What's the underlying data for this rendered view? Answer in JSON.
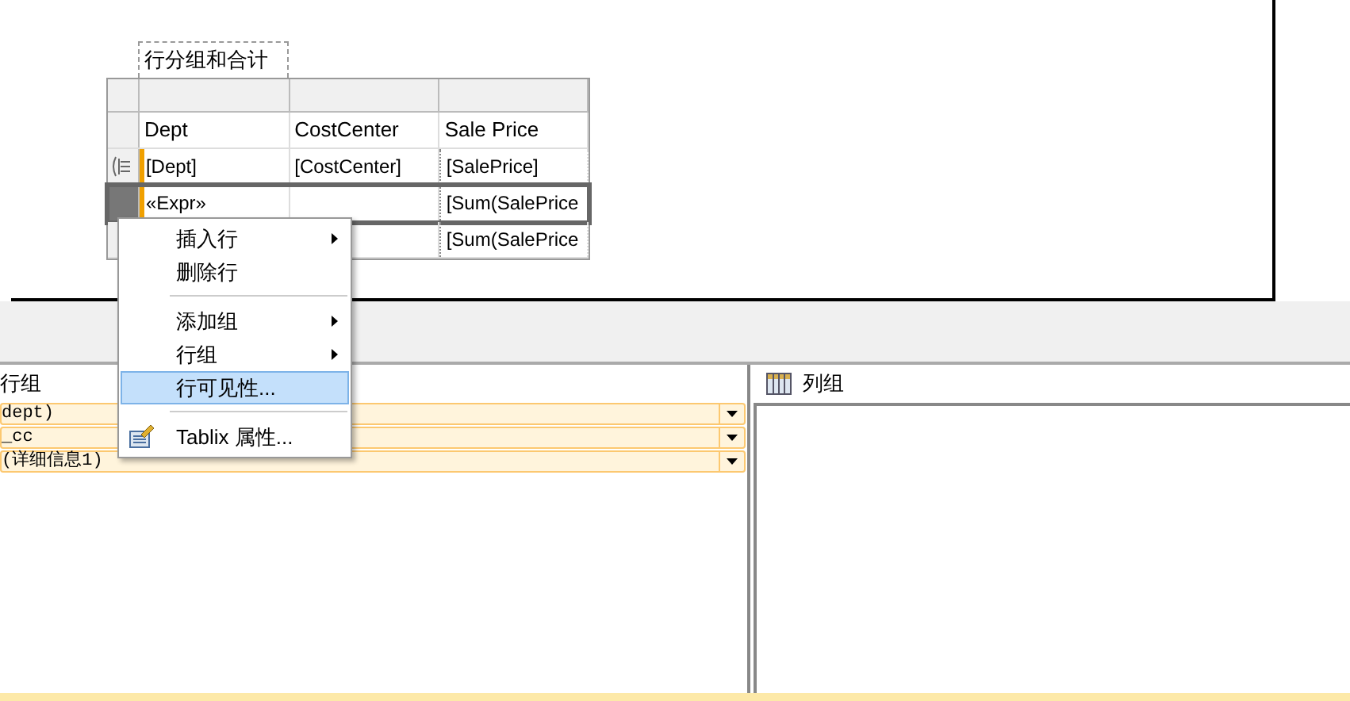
{
  "report": {
    "title": "行分组和合计",
    "columns": [
      "Dept",
      "CostCenter",
      "Sale Price"
    ],
    "rows": [
      {
        "cells": [
          "[Dept]",
          "[CostCenter]",
          "[SalePrice]"
        ],
        "selected": false
      },
      {
        "cells": [
          "«Expr»",
          "",
          "[Sum(SalePrice"
        ],
        "selected": true
      },
      {
        "cells": [
          "",
          "",
          "[Sum(SalePrice"
        ],
        "selected": false
      }
    ]
  },
  "context_menu": [
    {
      "kind": "item",
      "label": "插入行",
      "submenu": true,
      "selected": false
    },
    {
      "kind": "item",
      "label": "删除行",
      "submenu": false,
      "selected": false
    },
    {
      "kind": "separator"
    },
    {
      "kind": "item",
      "label": "添加组",
      "submenu": true,
      "selected": false
    },
    {
      "kind": "item",
      "label": "行组",
      "submenu": true,
      "selected": false
    },
    {
      "kind": "item",
      "label": "行可见性...",
      "submenu": false,
      "selected": true
    },
    {
      "kind": "separator"
    },
    {
      "kind": "icon-item",
      "label": "Tablix 属性...",
      "submenu": false,
      "selected": false
    }
  ],
  "row_groups": {
    "title": "行组",
    "items": [
      "dept)",
      "_cc",
      "(详细信息1)"
    ]
  },
  "column_groups": {
    "title": "列组"
  }
}
